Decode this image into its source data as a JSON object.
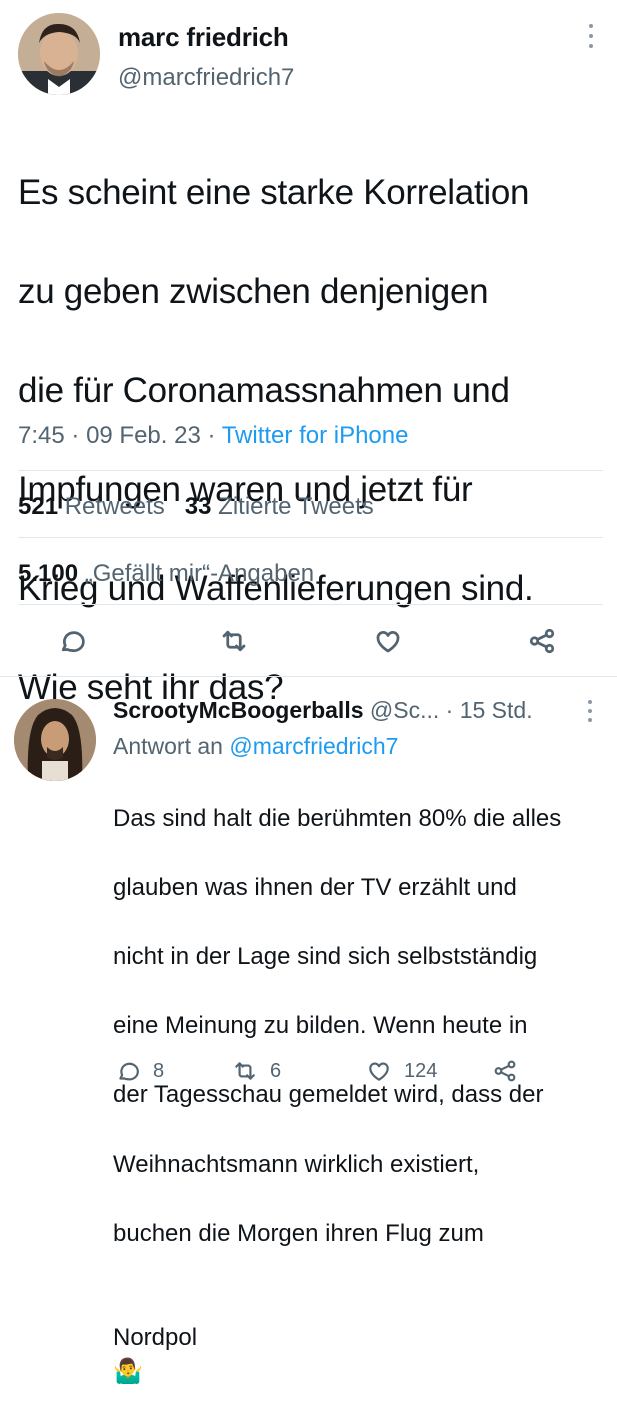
{
  "tweet": {
    "author_name": "marc friedrich",
    "author_handle": "@marcfriedrich7",
    "text_lines": [
      "Es scheint eine starke Korrelation",
      "zu geben zwischen denjenigen",
      "die für Coronamassnahmen und",
      "Impfungen waren und jetzt für",
      "Krieg und Waffenlieferungen sind.",
      "Wie seht ihr das?"
    ],
    "time": "7:45",
    "date": "09 Feb. 23",
    "source": "Twitter for iPhone",
    "stats": {
      "retweets_count": "521",
      "retweets_label": "Retweets",
      "quotes_count": "33",
      "quotes_label": "Zitierte Tweets",
      "likes_count": "5.100",
      "likes_label": "„Gefällt mir“-Angaben"
    },
    "actions": [
      "reply-icon",
      "retweet-icon",
      "like-icon",
      "share-icon"
    ]
  },
  "reply": {
    "author_name": "ScrootyMcBoogerballs",
    "author_handle": "@Sc...",
    "time": "15 Std.",
    "reply_to_label": "Antwort an",
    "reply_to_handle": "@marcfriedrich7",
    "text_lines": [
      "Das sind halt die berühmten 80% die alles",
      "glauben was ihnen der TV erzählt und",
      "nicht in der Lage sind sich selbstständig",
      "eine Meinung zu bilden. Wenn heute in",
      "der Tagesschau gemeldet wird, dass der",
      "Weihnachtsmann wirklich existiert,",
      "buchen die Morgen ihren Flug zum",
      "Nordpol"
    ],
    "emoji": "🤷‍♂️",
    "counts": {
      "replies": "8",
      "retweets": "6",
      "likes": "124"
    }
  },
  "colors": {
    "accent": "#1d9bf0",
    "secondary_text": "#536471",
    "divider": "#e3e7ea"
  }
}
